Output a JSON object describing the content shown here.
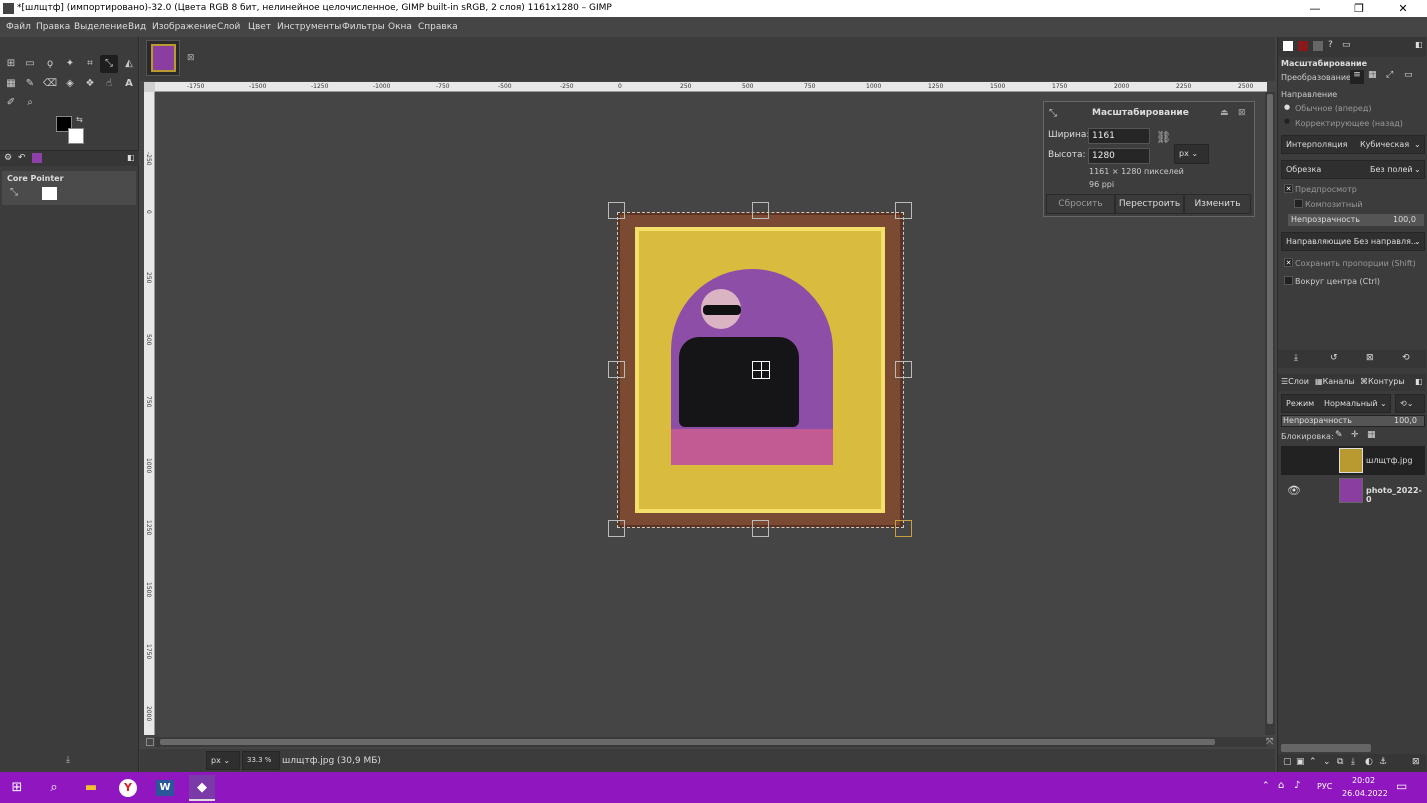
{
  "window": {
    "title": "*[шлщтф] (импортировано)-32.0 (Цвета RGB 8 бит, нелинейное целочисленное, GIMP built-in sRGB, 2 слоя) 1161x1280 – GIMP",
    "minimize": "—",
    "maximize": "❐",
    "close": "✕"
  },
  "menu": [
    "Файл",
    "Правка",
    "Выделение",
    "Вид",
    "Изображение",
    "Слой",
    "Цвет",
    "Инструменты",
    "Фильтры",
    "Окна",
    "Справка"
  ],
  "toolbox": {
    "device_title": "Core Pointer"
  },
  "ruler": {
    "h_ticks": [
      "-1750",
      "-1500",
      "-1250",
      "-1000",
      "-750",
      "-500",
      "-250",
      "0",
      "250",
      "500",
      "750",
      "1000",
      "1250",
      "1500",
      "1750",
      "2000",
      "2250",
      "2500"
    ],
    "v_ticks": [
      "-250",
      "0",
      "250",
      "500",
      "750",
      "1000",
      "1250",
      "1500",
      "1750",
      "2000"
    ]
  },
  "scale_dialog": {
    "title": "Масштабирование",
    "width_label": "Ширина:",
    "width_value": "1161",
    "height_label": "Высота:",
    "height_value": "1280",
    "unit": "px",
    "size_info": "1161 × 1280 пикселей",
    "ppi": "96 ppi",
    "reset": "Сбросить",
    "readjust": "Перестроить",
    "apply": "Изменить"
  },
  "status": {
    "unit": "px",
    "zoom": "33.3 %",
    "file_info": "шлщтф.jpg (30,9 МБ)"
  },
  "tool_options": {
    "title": "Масштабирование",
    "transform_label": "Преобразование:",
    "direction_label": "Направление",
    "direction_forward": "Обычное (вперед)",
    "direction_backward": "Корректирующее (назад)",
    "interpolation_label": "Интерполяция",
    "interpolation_value": "Кубическая",
    "clipping_label": "Обрезка",
    "clipping_value": "Без полей",
    "preview": "Предпросмотр",
    "composited": "Композитный",
    "opacity_label": "Непрозрачность",
    "opacity_value": "100,0",
    "guides": "Направляющие Без направля...",
    "keep_aspect": "Сохранить пропорции  (Shift)",
    "around_center": "Вокруг центра (Ctrl)"
  },
  "layers_panel": {
    "tabs": [
      "Слои",
      "Каналы",
      "Контуры"
    ],
    "mode_label": "Режим",
    "mode_value": "Нормальный",
    "opacity_label": "Непрозрачность",
    "opacity_value": "100,0",
    "lock_label": "Блокировка:",
    "layers": [
      {
        "name": "шлщтф.jpg",
        "visible": false
      },
      {
        "name": "photo_2022-0",
        "visible": true
      }
    ]
  },
  "taskbar": {
    "lang": "РУС",
    "time": "20:02",
    "date": "26.04.2022",
    "accent": "#9016c0"
  }
}
